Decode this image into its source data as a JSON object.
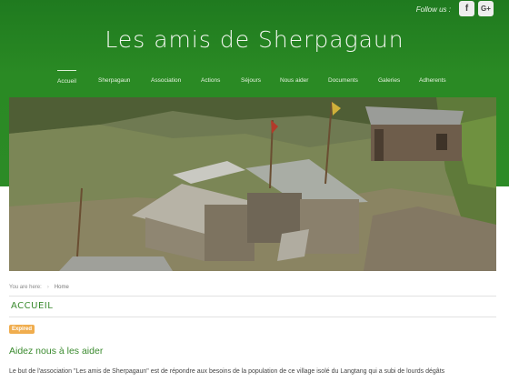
{
  "header": {
    "follow_label": "Follow us :",
    "social": [
      {
        "icon": "facebook-icon",
        "glyph": "f"
      },
      {
        "icon": "google-plus-icon",
        "glyph": "G+"
      }
    ],
    "site_title": "Les amis de Sherpagaun",
    "background_color": "#2c8b26"
  },
  "nav": {
    "items": [
      {
        "label": "Accueil",
        "active": true
      },
      {
        "label": "Sherpagaun"
      },
      {
        "label": "Association"
      },
      {
        "label": "Actions"
      },
      {
        "label": "Séjours"
      },
      {
        "label": "Nous aider"
      },
      {
        "label": "Documents"
      },
      {
        "label": "Galeries"
      },
      {
        "label": "Adherents"
      }
    ]
  },
  "breadcrumb": {
    "prefix": "You are here:",
    "items": [
      "Home"
    ]
  },
  "page": {
    "title": "ACCUEIL",
    "badge": "Expired",
    "badge_color": "#f0ad4e",
    "article_title": "Aidez nous à les aider",
    "body": "Le but de l'association \"Les amis de Sherpagaun\" est de répondre aux besoins de la population de ce village isolé du Langtang qui a subi de lourds dégâts",
    "accent_color": "#3a8a2e"
  }
}
